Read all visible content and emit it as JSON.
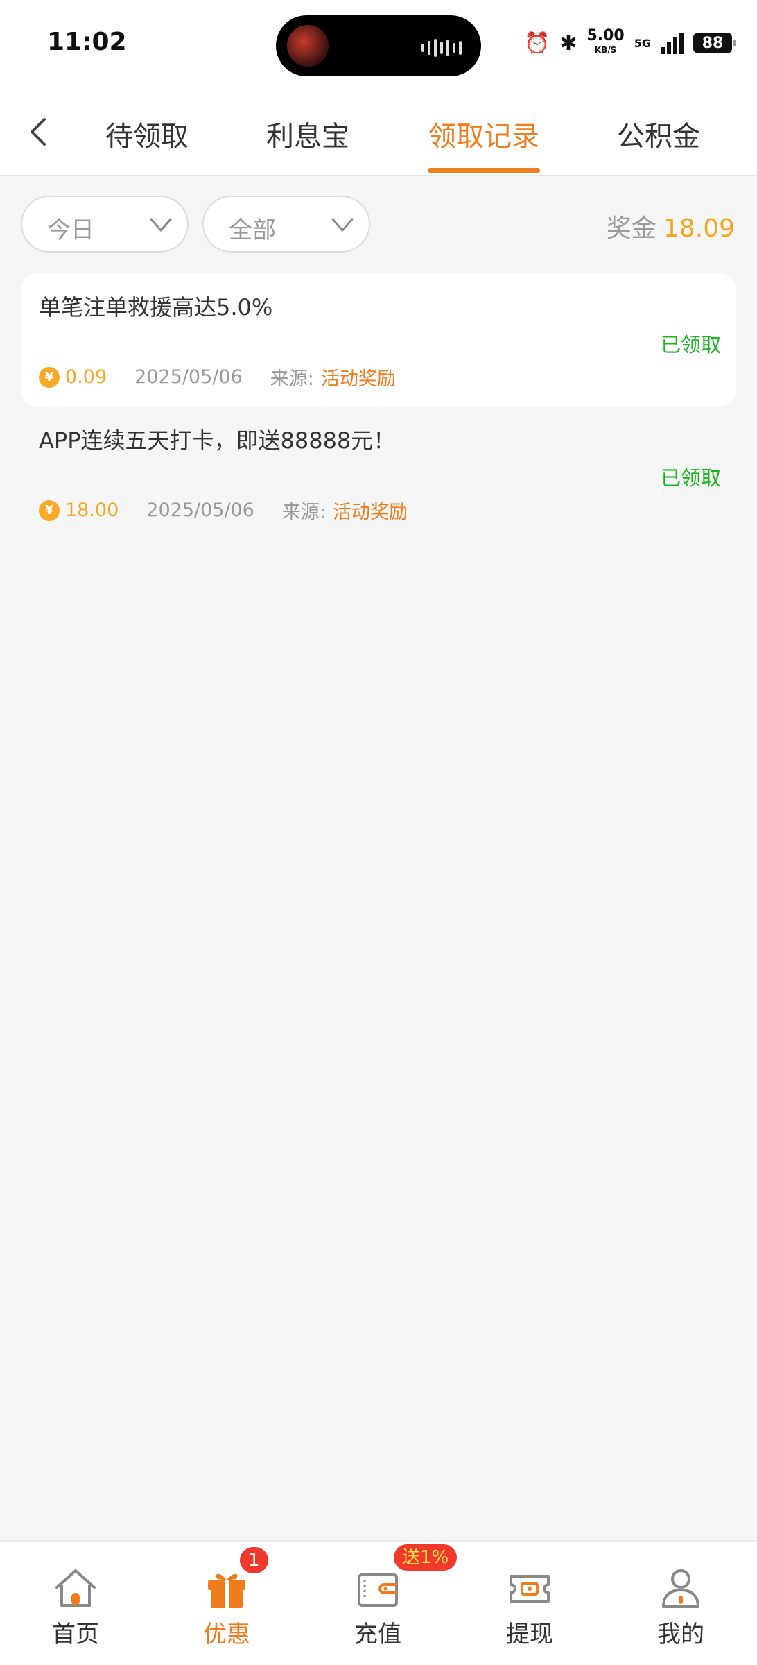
{
  "status_bar": {
    "time": "11:02",
    "net_speed": "5.00",
    "net_unit": "KB/S",
    "network": "5G",
    "battery": "88"
  },
  "tabs": [
    {
      "label": "待领取",
      "active": false
    },
    {
      "label": "利息宝",
      "active": false
    },
    {
      "label": "领取记录",
      "active": true
    },
    {
      "label": "公积金",
      "active": false
    }
  ],
  "filters": {
    "date": "今日",
    "type": "全部"
  },
  "bonus": {
    "label": "奖金",
    "value": "18.09"
  },
  "records": [
    {
      "title": "单笔注单救援高达5.0%",
      "status": "已领取",
      "amount": "0.09",
      "date": "2025/05/06",
      "source_label": "来源:",
      "source": "活动奖励"
    },
    {
      "title": "APP连续五天打卡，即送88888元！",
      "status": "已领取",
      "amount": "18.00",
      "date": "2025/05/06",
      "source_label": "来源:",
      "source": "活动奖励"
    }
  ],
  "coin_symbol": "¥",
  "bottom_nav": [
    {
      "label": "首页",
      "icon": "home-icon",
      "active": false
    },
    {
      "label": "优惠",
      "icon": "gift-icon",
      "active": true,
      "badge": "1"
    },
    {
      "label": "充值",
      "icon": "wallet-icon",
      "active": false,
      "badge": "送1%"
    },
    {
      "label": "提现",
      "icon": "withdraw-icon",
      "active": false
    },
    {
      "label": "我的",
      "icon": "profile-icon",
      "active": false
    }
  ],
  "colors": {
    "accent": "#f07c1e",
    "gold": "#f5a623",
    "success": "#19b41d",
    "badge": "#f0392b"
  }
}
